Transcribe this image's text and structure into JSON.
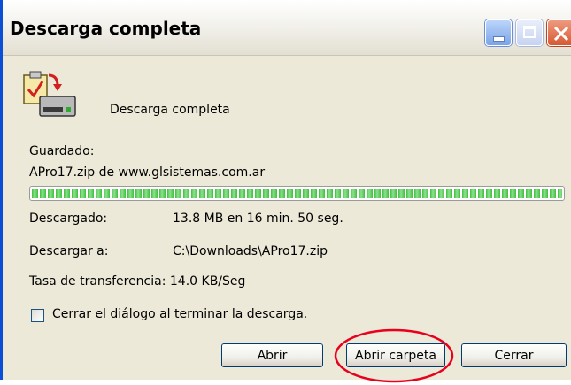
{
  "window": {
    "title": "Descarga completa"
  },
  "titlebar_buttons": {
    "minimize_icon": "minimize-icon",
    "maximize_icon": "maximize-icon",
    "close_icon": "close-icon"
  },
  "header": {
    "icon": "download-complete-icon",
    "message": "Descarga completa"
  },
  "details": {
    "saved_label": "Guardado:",
    "saved_file": "APro17.zip de www.glsistemas.com.ar",
    "progress": 1.0,
    "downloaded_label": "Descargado:",
    "downloaded_value": "13.8 MB en 16 min. 50 seg.",
    "download_to_label": "Descargar a:",
    "download_to_value": "C:\\Downloads\\APro17.zip",
    "transfer_rate": "Tasa de transferencia: 14.0 KB/Seg"
  },
  "options": {
    "close_on_finish_label": "Cerrar el diálogo al terminar la descarga.",
    "close_on_finish_checked": false
  },
  "buttons": {
    "open": "Abrir",
    "open_folder": "Abrir carpeta",
    "close": "Cerrar"
  },
  "colors": {
    "titlebar_border": "#0b4fd6",
    "progress_green": "#3fbf3f",
    "highlight_ellipse": "#e8001c",
    "button_border": "#003c74"
  }
}
